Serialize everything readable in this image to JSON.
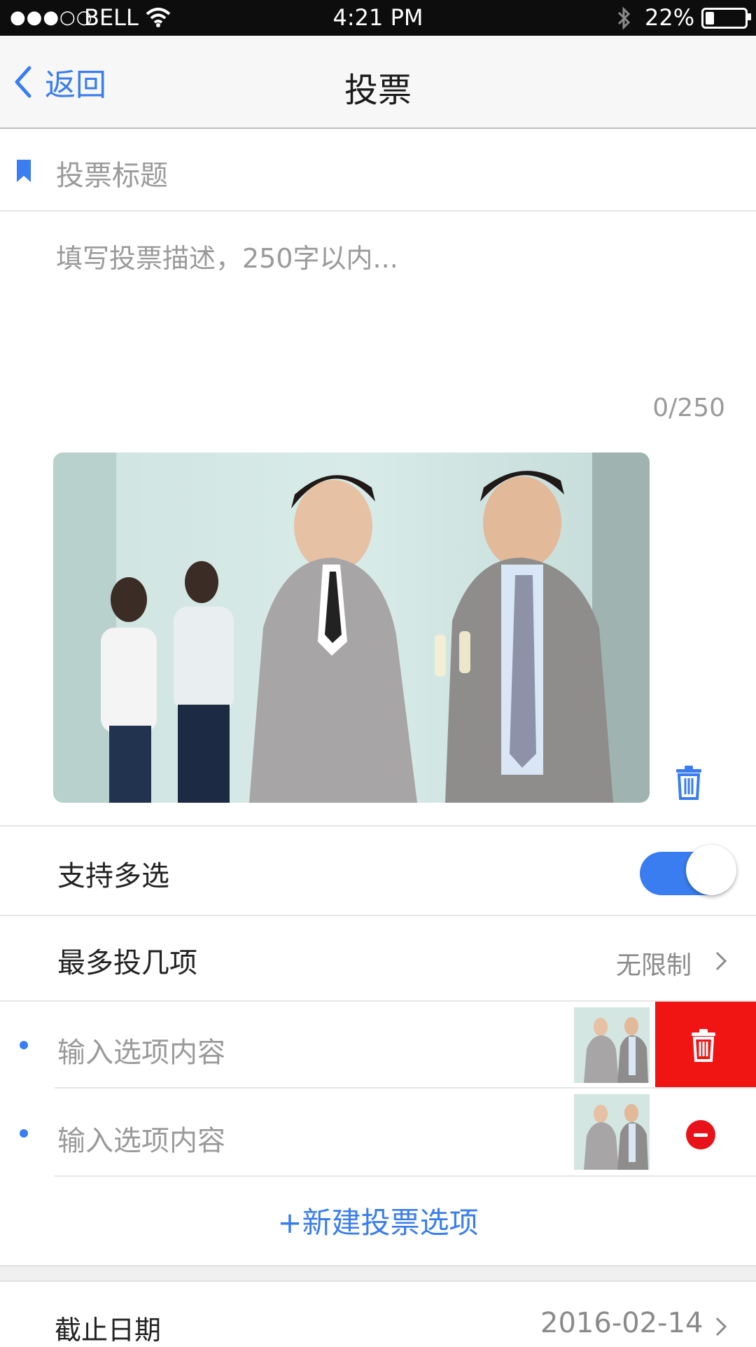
{
  "status_bar": {
    "signal_dots": "●●●○○",
    "carrier": "BELL",
    "wifi_icon": "wifi-icon",
    "time": "4:21 PM",
    "bluetooth_icon": "bluetooth-icon",
    "battery_percent": "22%",
    "battery_level": 0.22
  },
  "nav": {
    "back_label": "返回",
    "title": "投票"
  },
  "form": {
    "title_placeholder": "投票标题",
    "description_placeholder": "填写投票描述，250字以内...",
    "char_counter": "0/250"
  },
  "settings": {
    "multi_select_label": "支持多选",
    "multi_select_on": true,
    "max_votes_label": "最多投几项",
    "max_votes_value": "无限制"
  },
  "options": [
    {
      "placeholder": "输入选项内容"
    },
    {
      "placeholder": "输入选项内容"
    }
  ],
  "add_option_label": "+新建投票选项",
  "deadline": {
    "label": "截止日期",
    "value": "2016-02-14"
  },
  "colors": {
    "accent": "#3a7df0",
    "delete_red": "#f01413"
  }
}
